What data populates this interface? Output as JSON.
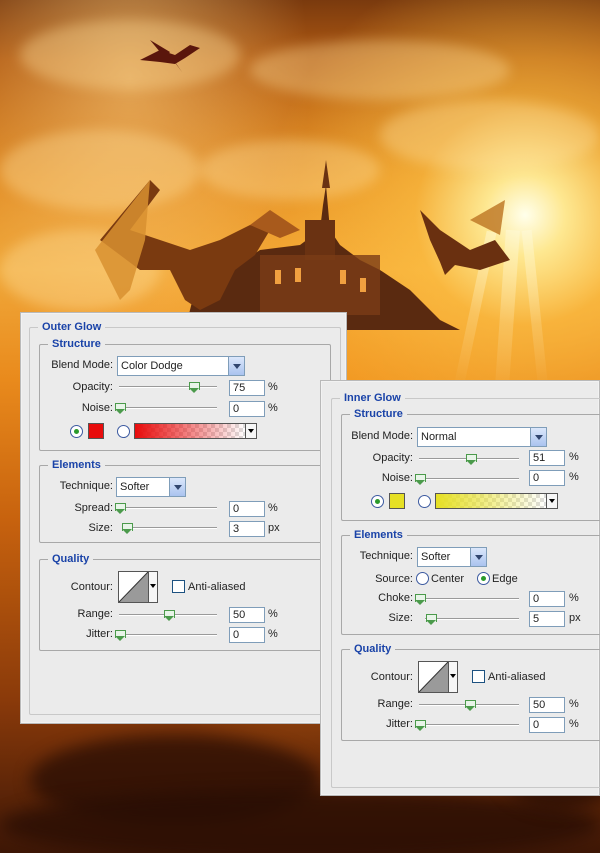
{
  "colors": {
    "accent": "#1a43a8",
    "outer_glow_color": "#e80c0c",
    "inner_glow_color": "#e6e024"
  },
  "outer_glow": {
    "title": "Outer Glow",
    "structure": {
      "title": "Structure",
      "blend_mode_label": "Blend Mode:",
      "blend_mode_value": "Color Dodge",
      "opacity_label": "Opacity:",
      "opacity_value": "75",
      "opacity_level": 75,
      "noise_label": "Noise:",
      "noise_value": "0",
      "noise_level": 0,
      "unit": "%"
    },
    "elements": {
      "title": "Elements",
      "technique_label": "Technique:",
      "technique_value": "Softer",
      "spread_label": "Spread:",
      "spread_value": "0",
      "spread_level": 0,
      "size_label": "Size:",
      "size_value": "3",
      "size_level": 3,
      "pct_unit": "%",
      "px_unit": "px"
    },
    "quality": {
      "title": "Quality",
      "contour_label": "Contour:",
      "anti_aliased_label": "Anti-aliased",
      "range_label": "Range:",
      "range_value": "50",
      "range_level": 50,
      "jitter_label": "Jitter:",
      "jitter_value": "0",
      "jitter_level": 0,
      "unit": "%"
    }
  },
  "inner_glow": {
    "title": "Inner Glow",
    "structure": {
      "title": "Structure",
      "blend_mode_label": "Blend Mode:",
      "blend_mode_value": "Normal",
      "opacity_label": "Opacity:",
      "opacity_value": "51",
      "opacity_level": 51,
      "noise_label": "Noise:",
      "noise_value": "0",
      "noise_level": 0,
      "unit": "%"
    },
    "elements": {
      "title": "Elements",
      "technique_label": "Technique:",
      "technique_value": "Softer",
      "source_label": "Source:",
      "source_center": "Center",
      "source_edge": "Edge",
      "choke_label": "Choke:",
      "choke_value": "0",
      "choke_level": 0,
      "size_label": "Size:",
      "size_value": "5",
      "size_level": 5,
      "pct_unit": "%",
      "px_unit": "px"
    },
    "quality": {
      "title": "Quality",
      "contour_label": "Contour:",
      "anti_aliased_label": "Anti-aliased",
      "range_label": "Range:",
      "range_value": "50",
      "range_level": 50,
      "jitter_label": "Jitter:",
      "jitter_value": "0",
      "jitter_level": 0,
      "unit": "%"
    }
  }
}
